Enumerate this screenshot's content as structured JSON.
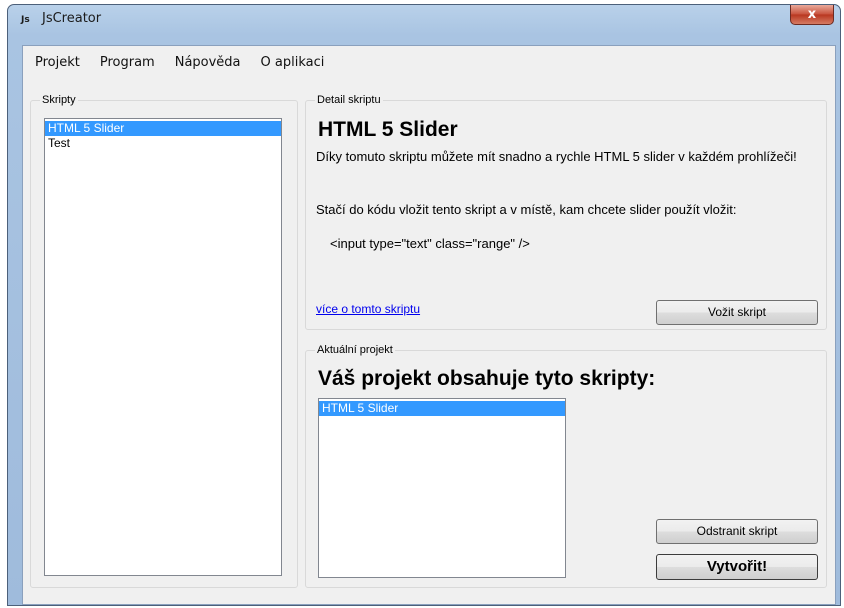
{
  "window": {
    "title": "JsCreator",
    "icon_text": "Js",
    "close_label": "x"
  },
  "menu": [
    {
      "label": "Projekt"
    },
    {
      "label": "Program"
    },
    {
      "label": "Nápověda"
    },
    {
      "label": "O aplikaci"
    }
  ],
  "scripts": {
    "label": "Skripty",
    "items": [
      {
        "label": "HTML 5 Slider",
        "selected": true
      },
      {
        "label": "Test",
        "selected": false
      }
    ]
  },
  "detail": {
    "label": "Detail skriptu",
    "title": "HTML 5 Slider",
    "description": "Díky tomuto skriptu můžete mít snadno a rychle HTML 5 slider v každém prohlížeči!",
    "instruction": "Stačí do kódu vložit tento skript a v místě, kam chcete slider použít vložit:",
    "code": "<input type=\"text\" class=\"range\" />",
    "link": "více o tomto skriptu",
    "insert_button": "Vožit skript"
  },
  "project": {
    "label": "Aktuální projekt",
    "heading": "Váš projekt obsahuje tyto skripty:",
    "items": [
      {
        "label": "HTML 5 Slider",
        "selected": true
      }
    ],
    "remove_button": "Odstranit skript",
    "create_button": "Vytvořit!"
  }
}
